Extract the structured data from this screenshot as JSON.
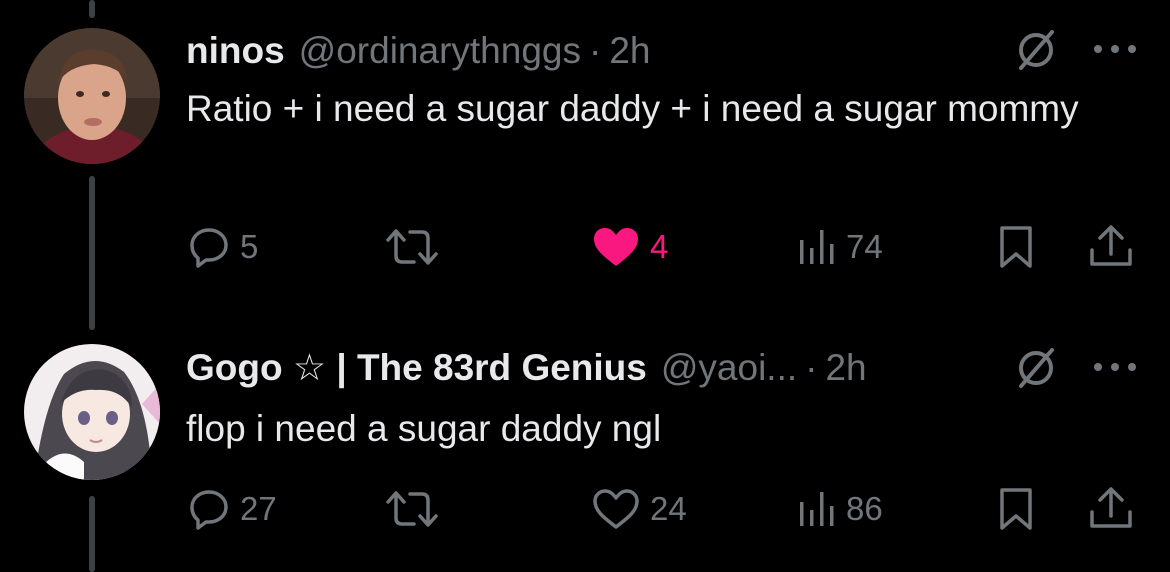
{
  "tweets": [
    {
      "name": "ninos",
      "handle": "@ordinarythnggs",
      "separator": "·",
      "time": "2h",
      "text": "Ratio + i need a sugar daddy + i need a sugar mommy",
      "replies": "5",
      "retweets": "",
      "likes": "4",
      "liked": true,
      "views": "74"
    },
    {
      "name": "Gogo ☆ | The 83rd Genius",
      "handle": "@yaoi...",
      "separator": "·",
      "time": "2h",
      "text": "flop i need a sugar daddy ngl",
      "replies": "27",
      "retweets": "",
      "likes": "24",
      "liked": false,
      "views": "86"
    }
  ],
  "colors": {
    "background": "#000000",
    "text": "#e7e9ea",
    "muted": "#71767b",
    "like": "#f91880",
    "thread_line": "#3e4144"
  },
  "icons": [
    "grok-icon",
    "more-icon",
    "reply-icon",
    "retweet-icon",
    "heart-icon",
    "views-icon",
    "bookmark-icon",
    "share-icon"
  ]
}
